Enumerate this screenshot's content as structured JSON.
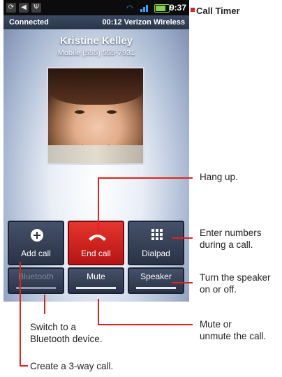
{
  "status_bar": {
    "time": "9:37",
    "sync_icon": "⟳",
    "phone_icon": "◀",
    "usb_icon": "Ψ"
  },
  "call_header": {
    "status": "Connected",
    "timer_and_carrier": "00:12 Verizon Wireless"
  },
  "caller": {
    "name": "Kristine Kelley",
    "number": "Mobile (555) 555-7931"
  },
  "buttons": {
    "add_call": "Add call",
    "end_call": "End call",
    "dialpad": "Dialpad",
    "bluetooth": "Bluetooth",
    "mute": "Mute",
    "speaker": "Speaker"
  },
  "annotations": {
    "call_timer": "Call Timer",
    "hang_up": "Hang up.",
    "enter_numbers": [
      "Enter numbers",
      "during a call."
    ],
    "speaker": [
      "Turn the speaker",
      "on or off."
    ],
    "mute": [
      "Mute or",
      "unmute the call."
    ],
    "bluetooth": [
      "Switch to a",
      "Bluetooth device."
    ],
    "add_call": "Create a 3-way call."
  },
  "colors": {
    "end_call": "#d42020",
    "callout": "#e0241b",
    "button_bg": "#2a3346"
  }
}
